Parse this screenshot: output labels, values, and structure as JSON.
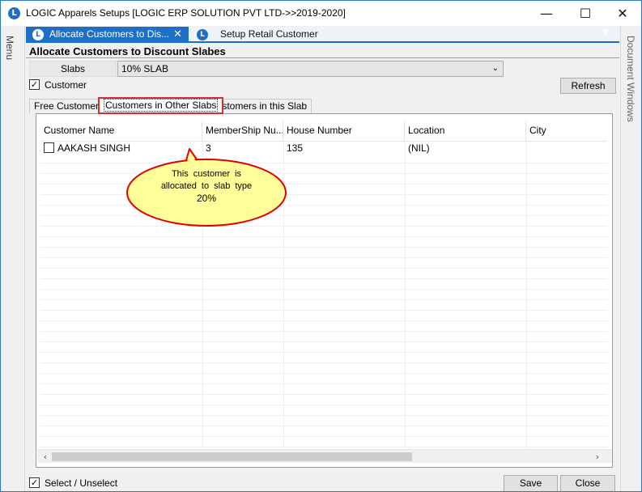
{
  "window": {
    "title": "LOGIC Apparels Setups  [LOGIC ERP SOLUTION PVT LTD->>2019-2020]",
    "minimize_glyph": "—",
    "maximize_glyph": "☐",
    "close_glyph": "✕",
    "app_icon_letter": "L",
    "accent_color": "#1e6fc8"
  },
  "side_rails": {
    "left_label": "Menu",
    "right_label": "Document Windows"
  },
  "doc_tabs": {
    "active_label": "Allocate Customers to Dis...",
    "active_close": "✕",
    "inactive_label": "Setup Retail Customer",
    "tab_icon_letter": "L",
    "dropdown_glyph": "▼"
  },
  "form": {
    "header": "Allocate Customers to Discount Slabes",
    "slabs_label": "Slabs",
    "slabs_value": "10% SLAB",
    "slabs_arrow": "⌄",
    "customer_checkbox_label": "Customer",
    "customer_checked": true,
    "check_glyph": "✓",
    "refresh_label": "Refresh"
  },
  "sub_tabs": [
    {
      "label": "Free Customers",
      "selected": false
    },
    {
      "label": "Customers in Other Slabs",
      "selected": true
    },
    {
      "label": "Customers in this Slab",
      "selected": false
    }
  ],
  "grid": {
    "columns": [
      "Customer Name",
      "MemberShip Nu...",
      "House Number",
      "Location",
      "City"
    ],
    "rows": [
      {
        "checked": false,
        "customer_name": "AAKASH   SINGH",
        "membership": "3",
        "house_number": "135",
        "location": "(NIL)",
        "city": ""
      }
    ],
    "scroll_left_glyph": "‹",
    "scroll_right_glyph": "›"
  },
  "callout": {
    "line1": "This  customer  is",
    "line2": "allocated  to  slab  type",
    "line3": "20%",
    "fill_color": "#ffff99",
    "border_color": "#e00000"
  },
  "footer": {
    "select_unselect_label": "Select / Unselect",
    "select_unselect_checked": true,
    "save_label": "Save",
    "close_label": "Close"
  }
}
